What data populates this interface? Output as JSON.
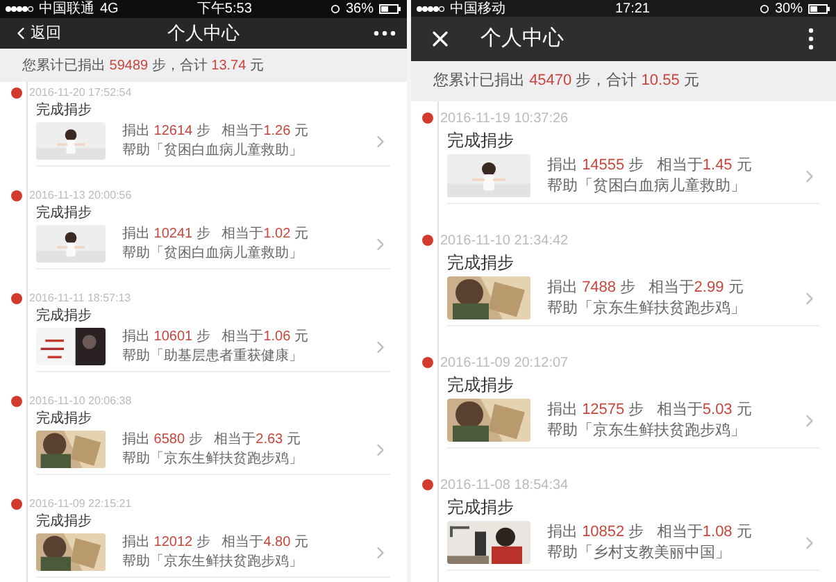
{
  "phones": [
    {
      "status_bar": {
        "carrier": "中国联通",
        "network": "4G",
        "time": "下午5:53",
        "battery": "36%"
      },
      "nav": {
        "kind": "back",
        "back_label": "返回",
        "title": "个人中心"
      },
      "summary": {
        "prefix": "您累计已捐出",
        "steps": "59489",
        "middle": "步，合计",
        "amount": "13.74",
        "suffix": "元"
      },
      "entries": [
        {
          "time": "2016-11-20 17:52:54",
          "title": "完成捐步",
          "donated_label": "捐出",
          "steps": "12614",
          "steps_unit": "步",
          "equivalent_label": "相当于",
          "amount": "1.26",
          "currency": "元",
          "cause": "帮助「贫困白血病儿童救助」",
          "kind": "picture"
        },
        {
          "time": "2016-11-13 20:00:56",
          "title": "完成捐步",
          "donated_label": "捐出",
          "steps": "10241",
          "steps_unit": "步",
          "equivalent_label": "相当于",
          "amount": "1.02",
          "currency": "元",
          "cause": "帮助「贫困白血病儿童救助」",
          "kind": "picture"
        },
        {
          "time": "2016-11-11 18:57:13",
          "title": "完成捐步",
          "donated_label": "捐出",
          "steps": "10601",
          "steps_unit": "步",
          "equivalent_label": "相当于",
          "amount": "1.06",
          "currency": "元",
          "cause": "帮助「助基层患者重获健康」",
          "kind": "picture"
        },
        {
          "time": "2016-11-10 20:06:38",
          "title": "完成捐步",
          "donated_label": "捐出",
          "steps": "6580",
          "steps_unit": "步",
          "equivalent_label": "相当于",
          "amount": "2.63",
          "currency": "元",
          "cause": "帮助「京东生鲜扶贫跑步鸡」",
          "kind": "picture"
        },
        {
          "time": "2016-11-09 22:15:21",
          "title": "完成捐步",
          "donated_label": "捐出",
          "steps": "12012",
          "steps_unit": "步",
          "equivalent_label": "相当于",
          "amount": "4.80",
          "currency": "元",
          "cause": "帮助「京东生鲜扶贫跑步鸡」",
          "kind": "picture"
        }
      ]
    },
    {
      "status_bar": {
        "carrier": "中国移动",
        "time": "17:21",
        "battery": "30%"
      },
      "nav": {
        "kind": "close",
        "title": "个人中心"
      },
      "summary": {
        "prefix": "您累计已捐出",
        "steps": "45470",
        "middle": "步，合计",
        "amount": "10.55",
        "suffix": "元"
      },
      "entries": [
        {
          "time": "2016-11-19 10:37:26",
          "title": "完成捐步",
          "donated_label": "捐出",
          "steps": "14555",
          "steps_unit": "步",
          "equivalent_label": "相当于",
          "amount": "1.45",
          "currency": "元",
          "cause": "帮助「贫困白血病儿童救助」",
          "kind": "picture"
        },
        {
          "time": "2016-11-10 21:34:42",
          "title": "完成捐步",
          "donated_label": "捐出",
          "steps": "7488",
          "steps_unit": "步",
          "equivalent_label": "相当于",
          "amount": "2.99",
          "currency": "元",
          "cause": "帮助「京东生鲜扶贫跑步鸡」",
          "kind": "picture"
        },
        {
          "time": "2016-11-09 20:12:07",
          "title": "完成捐步",
          "donated_label": "捐出",
          "steps": "12575",
          "steps_unit": "步",
          "equivalent_label": "相当于",
          "amount": "5.03",
          "currency": "元",
          "cause": "帮助「京东生鲜扶贫跑步鸡」",
          "kind": "picture"
        },
        {
          "time": "2016-11-08 18:54:34",
          "title": "完成捐步",
          "donated_label": "捐出",
          "steps": "10852",
          "steps_unit": "步",
          "equivalent_label": "相当于",
          "amount": "1.08",
          "currency": "元",
          "cause": "帮助「乡村支教美丽中国」",
          "kind": "picture"
        }
      ]
    }
  ]
}
